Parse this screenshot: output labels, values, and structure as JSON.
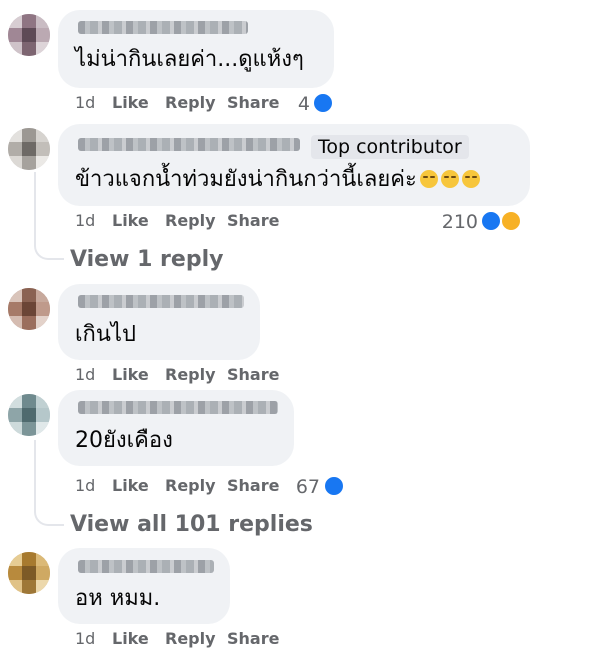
{
  "colors": {
    "bubble": "#f0f2f5",
    "secondary_text": "#65676b",
    "like_blue": "#1877f2",
    "badge_bg": "#e4e6eb"
  },
  "actions": {
    "time": "1d",
    "like": "Like",
    "reply": "Reply",
    "share": "Share"
  },
  "comments": [
    {
      "text": "ไม่น่ากินเลยค่า...ดูแห้งๆ",
      "reactions": {
        "count": "4",
        "icons": [
          "like-icon"
        ]
      }
    },
    {
      "badge": "Top contributor",
      "text": "ข้าวแจกน้ำท่วมยังน่ากินกว่านี้เลยค่ะ",
      "emoji": [
        "sleepy-face-emoji",
        "sleepy-face-emoji",
        "sleepy-face-emoji"
      ],
      "reactions": {
        "count": "210",
        "icons": [
          "like-icon",
          "haha-icon"
        ]
      },
      "view_replies": "View 1 reply"
    },
    {
      "text": "เกินไป"
    },
    {
      "text": "20ยังเคือง",
      "reactions": {
        "count": "67",
        "icons": [
          "like-icon"
        ]
      },
      "view_replies": "View all 101 replies"
    },
    {
      "text": "อห หมม."
    }
  ]
}
